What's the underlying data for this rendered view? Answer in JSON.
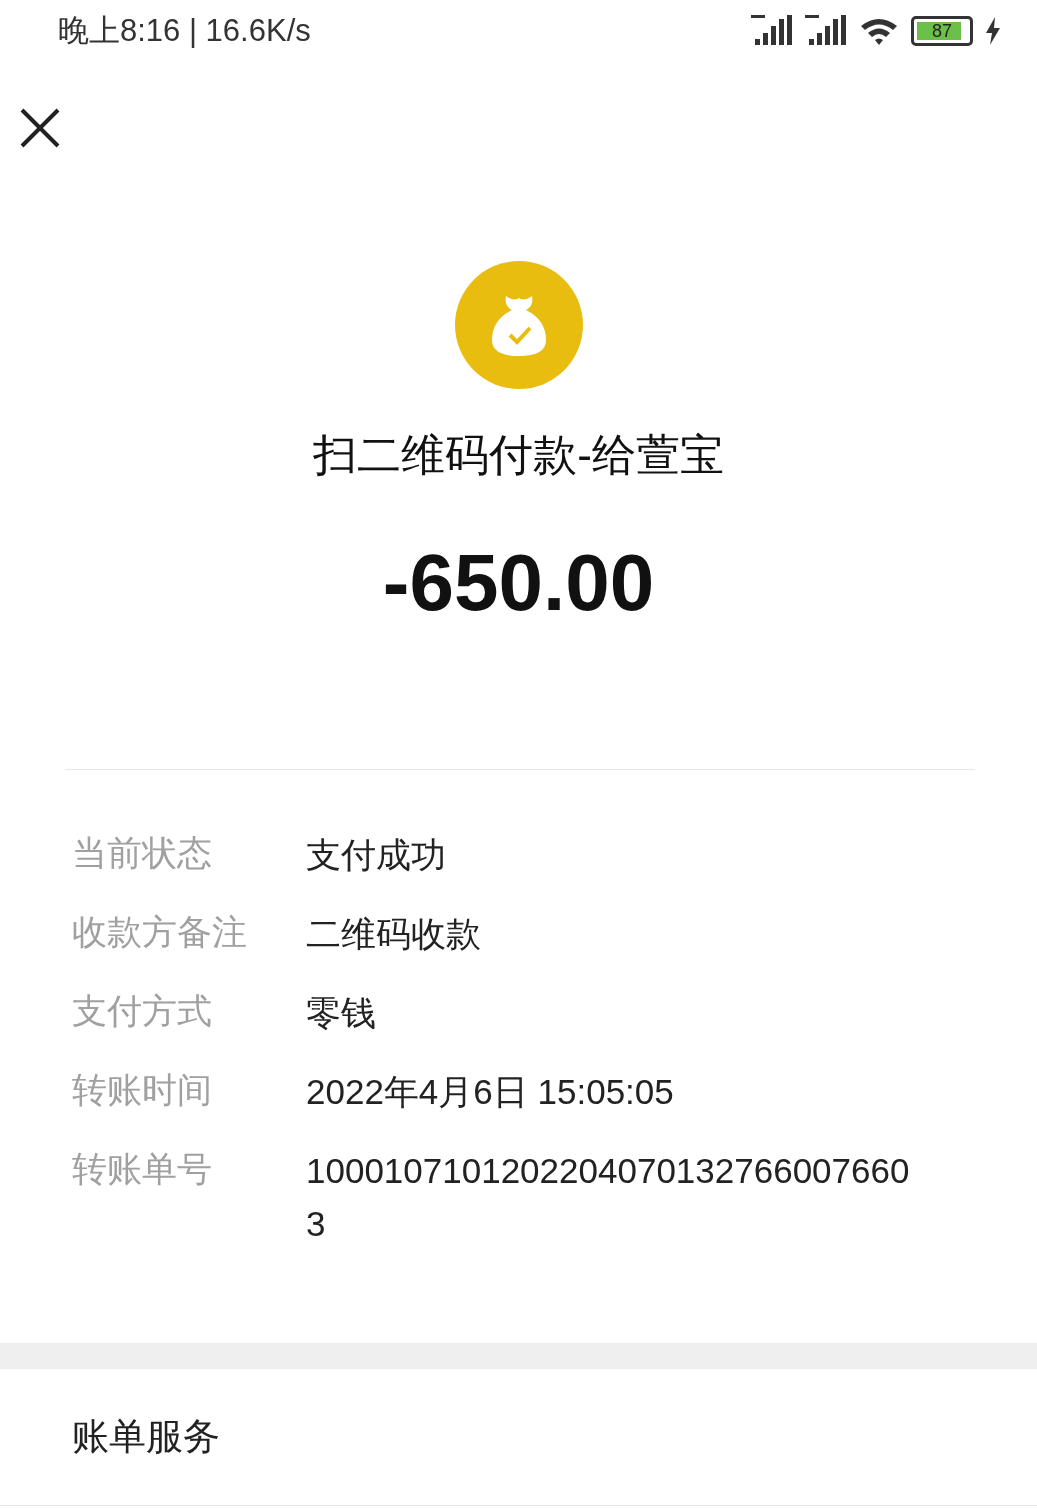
{
  "status_bar": {
    "time": "晚上8:16 | 16.6K/s",
    "battery": "87"
  },
  "title": "扫二维码付款-给萱宝",
  "amount": "-650.00",
  "details": [
    {
      "label": "当前状态",
      "value": "支付成功"
    },
    {
      "label": "收款方备注",
      "value": "二维码收款"
    },
    {
      "label": "支付方式",
      "value": "零钱"
    },
    {
      "label": "转账时间",
      "value": "2022年4月6日 15:05:05"
    },
    {
      "label": "转账单号",
      "value": "10001071012022040701327660076603"
    }
  ],
  "section": {
    "title": "账单服务"
  }
}
